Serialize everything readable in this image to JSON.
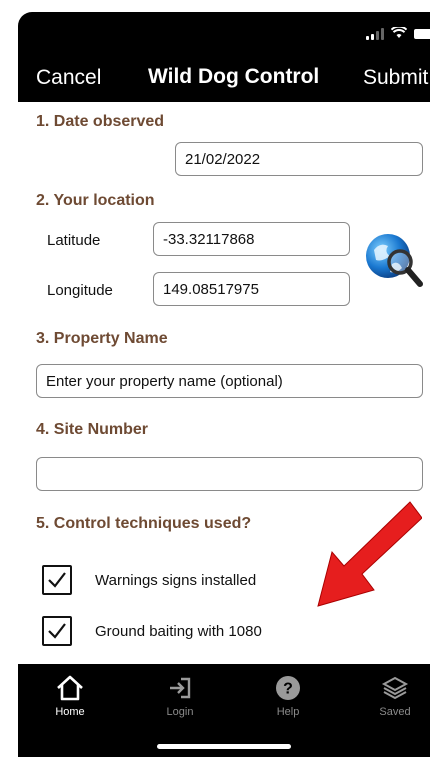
{
  "navbar": {
    "cancel": "Cancel",
    "title": "Wild Dog Control",
    "submit": "Submit"
  },
  "form": {
    "date_section": "1. Date observed",
    "date_value": "21/02/2022",
    "location_section": "2. Your location",
    "latitude_label": "Latitude",
    "latitude_value": "-33.32117868",
    "longitude_label": "Longitude",
    "longitude_value": "149.08517975",
    "property_section": "3. Property Name",
    "property_placeholder": "Enter your property name (optional)",
    "site_section": "4. Site Number",
    "site_value": "",
    "techniques_section": "5. Control techniques used?",
    "techniques": [
      {
        "label": "Warnings signs installed",
        "checked": true
      },
      {
        "label": "Ground baiting with 1080",
        "checked": true
      }
    ]
  },
  "tabbar": {
    "items": [
      {
        "label": "Home",
        "icon": "home-icon",
        "active": true
      },
      {
        "label": "Login",
        "icon": "login-icon",
        "active": false
      },
      {
        "label": "Help",
        "icon": "help-icon",
        "active": false
      },
      {
        "label": "Saved",
        "icon": "saved-icon",
        "active": false
      }
    ]
  },
  "colors": {
    "section_heading": "#6e4a33",
    "bars": "#000000",
    "arrow": "#e61e1e"
  }
}
